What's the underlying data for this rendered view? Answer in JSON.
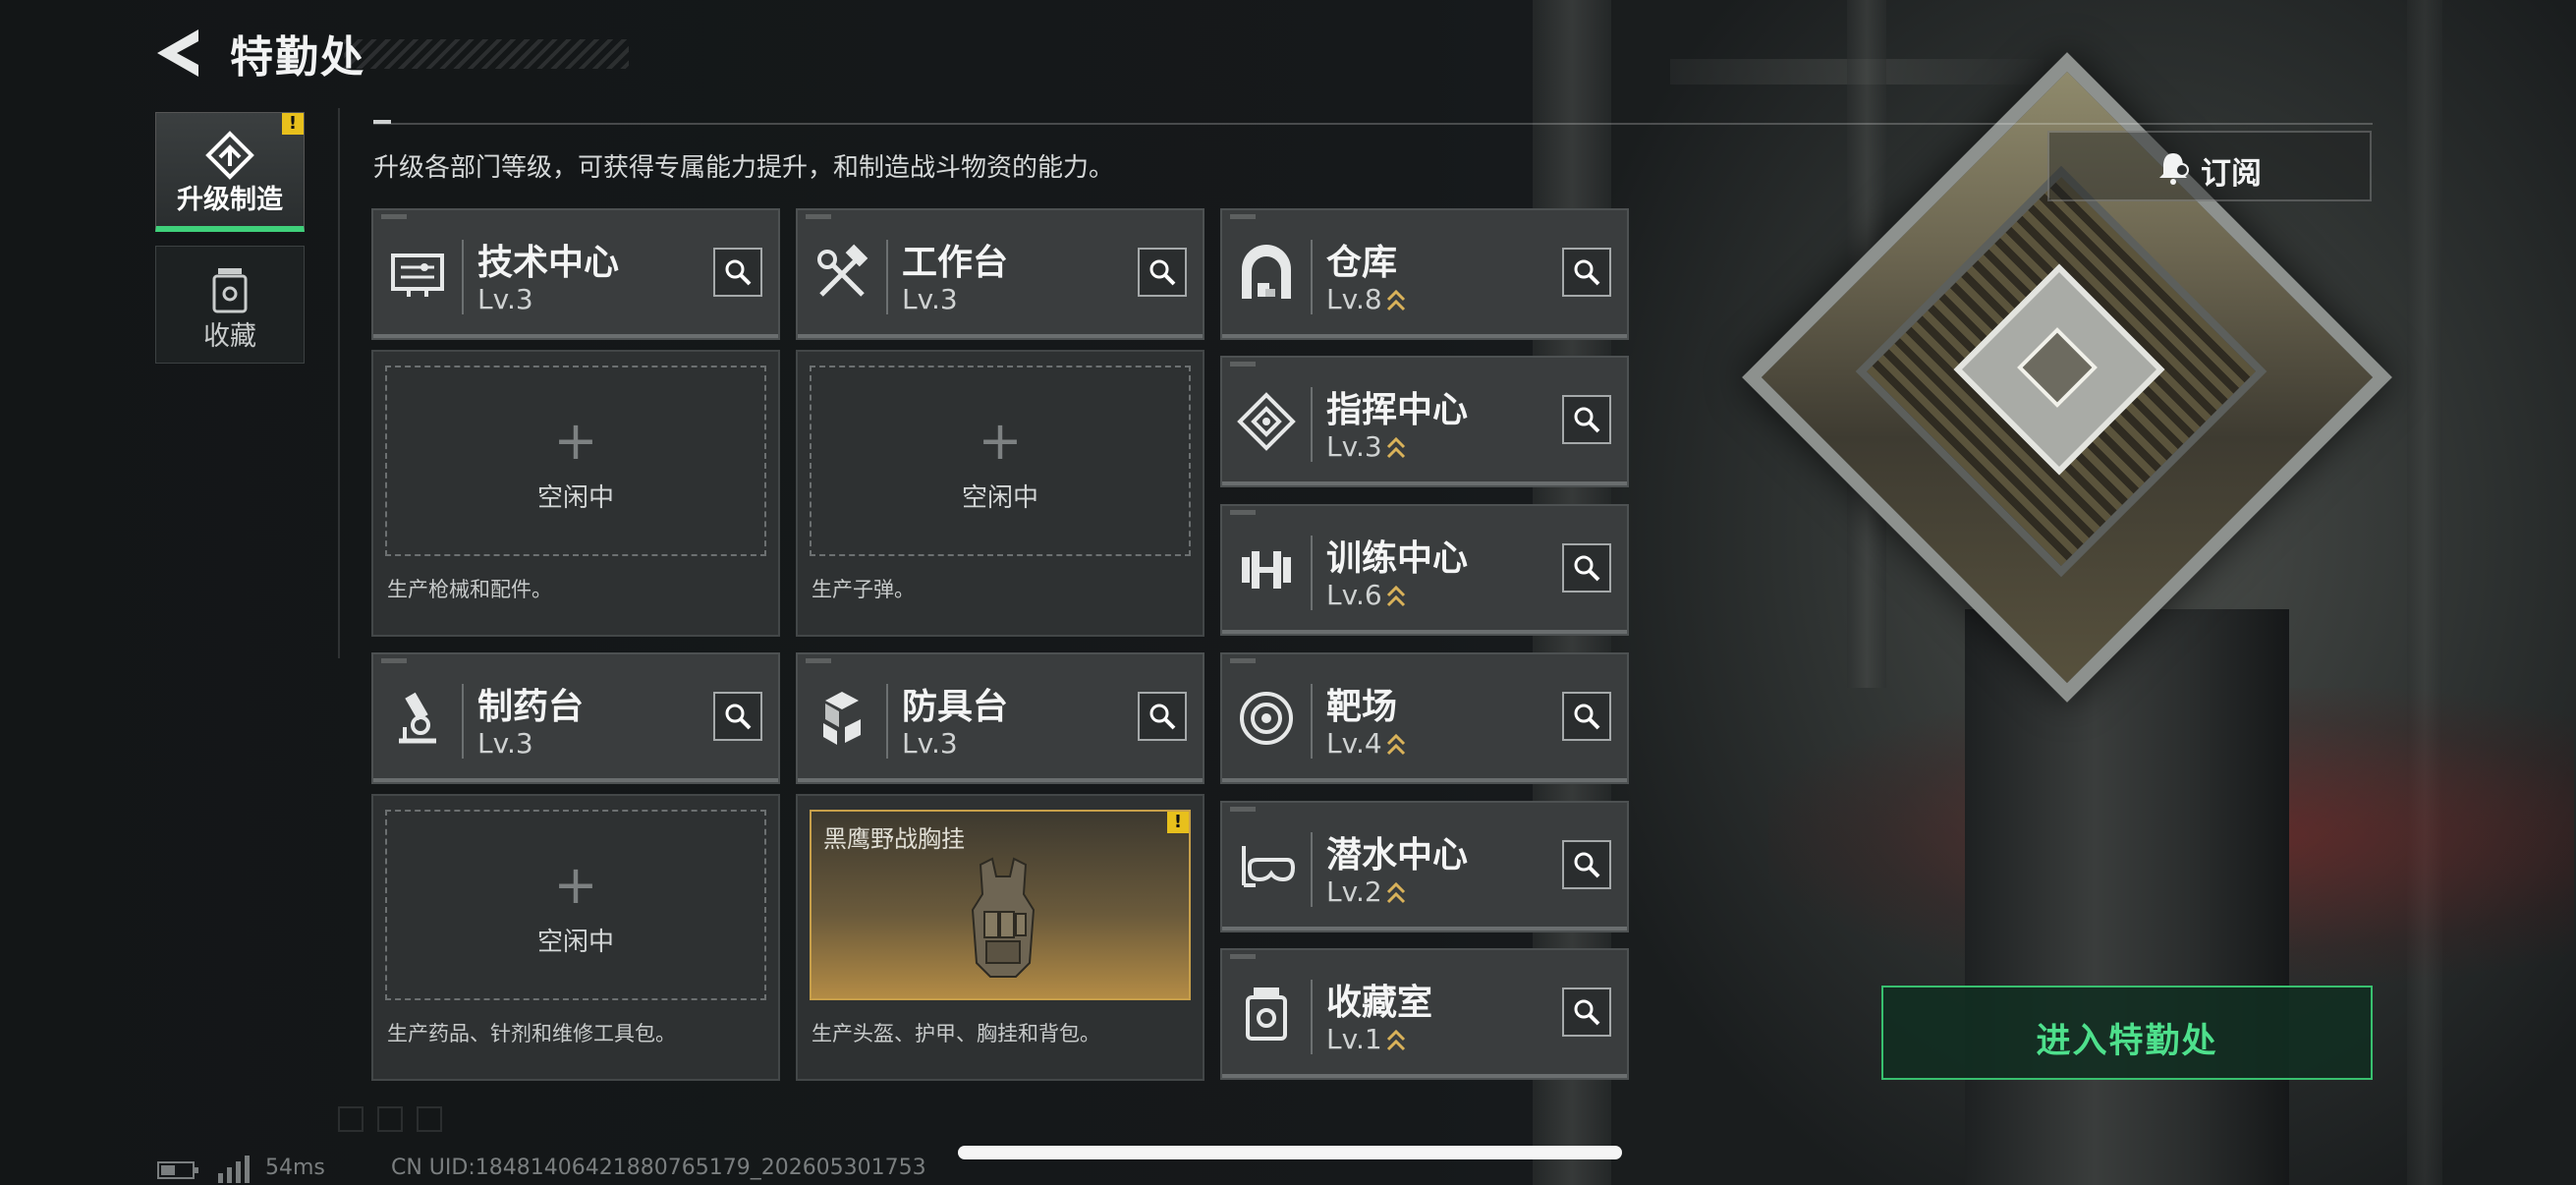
{
  "header": {
    "title": "特勤处",
    "back_icon": "back-arrow-icon"
  },
  "nav": {
    "tabs": [
      {
        "label": "升级制造",
        "icon": "upgrade-craft-icon",
        "active": true,
        "warning": "!"
      },
      {
        "label": "收藏",
        "icon": "collection-jar-icon",
        "active": false
      }
    ]
  },
  "description": "升级各部门等级，可获得专属能力提升，和制造战斗物资的能力。",
  "subscribe": {
    "label": "订阅",
    "icon": "bell-icon"
  },
  "workshops": [
    {
      "name": "技术中心",
      "level": "Lv.3",
      "icon": "tech-center-icon",
      "status": "空闲中",
      "plus": "+",
      "description": "生产枪械和配件。"
    },
    {
      "name": "工作台",
      "level": "Lv.3",
      "icon": "workbench-tools-icon",
      "status": "空闲中",
      "plus": "+",
      "description": "生产子弹。"
    },
    {
      "name": "制药台",
      "level": "Lv.3",
      "icon": "microscope-icon",
      "status": "空闲中",
      "plus": "+",
      "description": "生产药品、针剂和维修工具包。"
    },
    {
      "name": "防具台",
      "level": "Lv.3",
      "icon": "armor-cubes-icon",
      "item_name": "黑鹰野战胸挂",
      "warning": "!",
      "description": "生产头盔、护甲、胸挂和背包。"
    }
  ],
  "facilities": [
    {
      "name": "仓库",
      "level": "Lv.8",
      "icon": "warehouse-icon",
      "upgradable": true
    },
    {
      "name": "指挥中心",
      "level": "Lv.3",
      "icon": "command-center-icon",
      "upgradable": true
    },
    {
      "name": "训练中心",
      "level": "Lv.6",
      "icon": "dumbbell-icon",
      "upgradable": true
    },
    {
      "name": "靶场",
      "level": "Lv.4",
      "icon": "target-icon",
      "upgradable": true
    },
    {
      "name": "潜水中心",
      "level": "Lv.2",
      "icon": "diving-mask-icon",
      "upgradable": true
    },
    {
      "name": "收藏室",
      "level": "Lv.1",
      "icon": "collection-room-icon",
      "upgradable": true
    }
  ],
  "enter_button": {
    "label": "进入特勤处"
  },
  "footer": {
    "ping": "54ms",
    "uid": "CN UID:18481406421880765179_202605301753"
  },
  "colors": {
    "accent_green": "#3fd07a",
    "warning_yellow": "#e8c01c",
    "upgrade_gold": "#d9b25a"
  }
}
